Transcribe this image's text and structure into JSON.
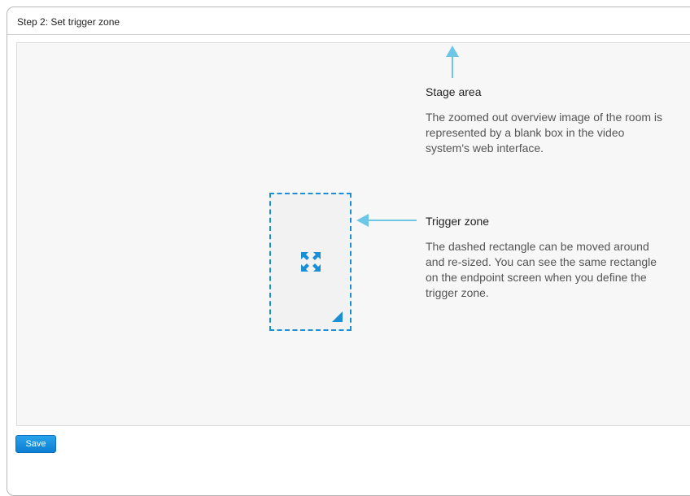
{
  "header": {
    "step_title": "Step 2: Set trigger zone"
  },
  "stage_callout": {
    "heading": "Stage area",
    "body": "The zoomed out overview image of the room is represented by a blank box in the video system's web interface."
  },
  "trigger_callout": {
    "heading": "Trigger zone",
    "body": "The dashed rectangle can be moved around and re-sized. You can see the same rectangle on the endpoint screen when you define the trigger zone."
  },
  "trigger_zone": {
    "move_icon": "move-arrows-icon",
    "resize_icon": "resize-corner-icon"
  },
  "footer": {
    "save_label": "Save"
  },
  "colors": {
    "accent": "#1a8fd4",
    "annotation_arrow": "#6ec6e6",
    "save_button": "#0d7fd1"
  }
}
